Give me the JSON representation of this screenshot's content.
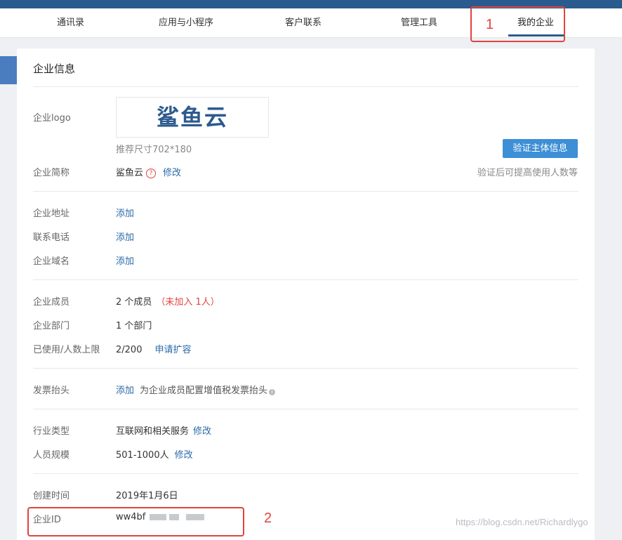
{
  "nav": {
    "tabs": [
      "通讯录",
      "应用与小程序",
      "客户联系",
      "管理工具",
      "我的企业"
    ],
    "active": "我的企业"
  },
  "markers": {
    "m1": "1",
    "m2": "2"
  },
  "panel": {
    "title": "企业信息",
    "logo": {
      "label": "企业logo",
      "text": "鲨鱼云",
      "hint": "推荐尺寸702*180"
    },
    "verify": {
      "button": "验证主体信息",
      "note": "验证后可提高使用人数等"
    },
    "short_name": {
      "label": "企业简称",
      "value": "鲨鱼云",
      "help": "?",
      "action": "修改"
    },
    "address": {
      "label": "企业地址",
      "action": "添加"
    },
    "phone": {
      "label": "联系电话",
      "action": "添加"
    },
    "domain": {
      "label": "企业域名",
      "action": "添加"
    },
    "members": {
      "label": "企业成员",
      "value": "2 个成员",
      "note": "（未加入 1人）"
    },
    "departments": {
      "label": "企业部门",
      "value": "1 个部门"
    },
    "quota": {
      "label": "已使用/人数上限",
      "value": "2/200",
      "action": "申请扩容"
    },
    "invoice": {
      "label": "发票抬头",
      "action": "添加",
      "desc": "为企业成员配置增值税发票抬头",
      "info": "i"
    },
    "industry": {
      "label": "行业类型",
      "value": "互联网和相关服务",
      "action": "修改"
    },
    "size": {
      "label": "人员规模",
      "value": "501-1000人",
      "action": "修改"
    },
    "created": {
      "label": "创建时间",
      "value": "2019年1月6日"
    },
    "corp_id": {
      "label": "企业ID",
      "value": "ww4bf"
    }
  },
  "watermark": "https://blog.csdn.net/Richardlygo",
  "colors": {
    "accent": "#2a5b8e",
    "link": "#2a6aa8",
    "marker": "#e0443e",
    "button": "#3d8fd6"
  }
}
